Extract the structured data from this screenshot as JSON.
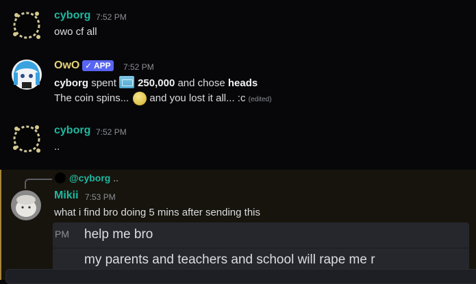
{
  "messages": [
    {
      "author": "cyborg",
      "time": "7:52 PM",
      "text": "owo cf all",
      "name_color": "#1fb8a1"
    },
    {
      "author": "OwO",
      "badge": "APP",
      "time": "7:52 PM",
      "line1_user": "cyborg",
      "line1_spent": "spent",
      "line1_amount": "250,000",
      "line1_chose": "and chose",
      "line1_choice": "heads",
      "line2_text": "The coin spins...",
      "line2_result": "and you lost it all... :c",
      "edited_label": "(edited)",
      "name_color": "#e8d27a"
    },
    {
      "author": "cyborg",
      "time": "7:52 PM",
      "text": "..",
      "name_color": "#1fb8a1"
    },
    {
      "author": "Mikii",
      "time": "7:53 PM",
      "text": "what i find bro doing 5 mins after sending this",
      "reply_to": "@cyborg",
      "reply_snippet": "..",
      "name_color": "#1fb8a1",
      "embed": {
        "pm_label": "PM",
        "line1": "help me bro",
        "line2": "my parents and teachers and school will rape me r"
      }
    }
  ],
  "icons": {
    "check": "checkmark-icon",
    "coin": "coin-icon",
    "cash": "cowoncy-icon"
  }
}
